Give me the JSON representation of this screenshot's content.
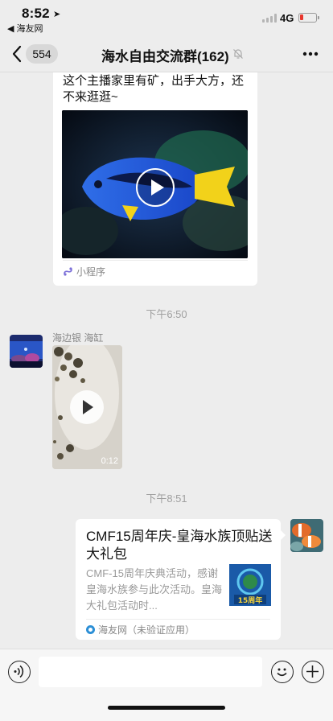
{
  "status_bar": {
    "time": "8:52",
    "back_app": "◀ 海友网",
    "network": "4G"
  },
  "nav": {
    "unread_count": "554",
    "title": "海水自由交流群(162)"
  },
  "messages": {
    "card1": {
      "text": "这个主播家里有矿，出手大方，还不来逛逛~",
      "app_label": "小程序"
    },
    "time1": "下午6:50",
    "msg2": {
      "sender": "海边银 海缸",
      "duration": "0:12"
    },
    "time2": "下午8:51",
    "card2": {
      "title": "CMF15周年庆-皇海水族顶贴送大礼包",
      "desc": "CMF-15周年庆典活动，感谢皇海水族参与此次活动。皇海大礼包活动时...",
      "source": "海友网（未验证应用）",
      "thumb_text": "15周年"
    }
  },
  "input": {
    "placeholder": ""
  },
  "icons": [
    "back-chevron-icon",
    "mute-bell-icon",
    "more-icon",
    "play-icon",
    "mini-program-icon",
    "voice-icon",
    "emoji-icon",
    "plus-icon"
  ],
  "colors": {
    "background": "#ededed",
    "battery_low": "#e8372e"
  }
}
